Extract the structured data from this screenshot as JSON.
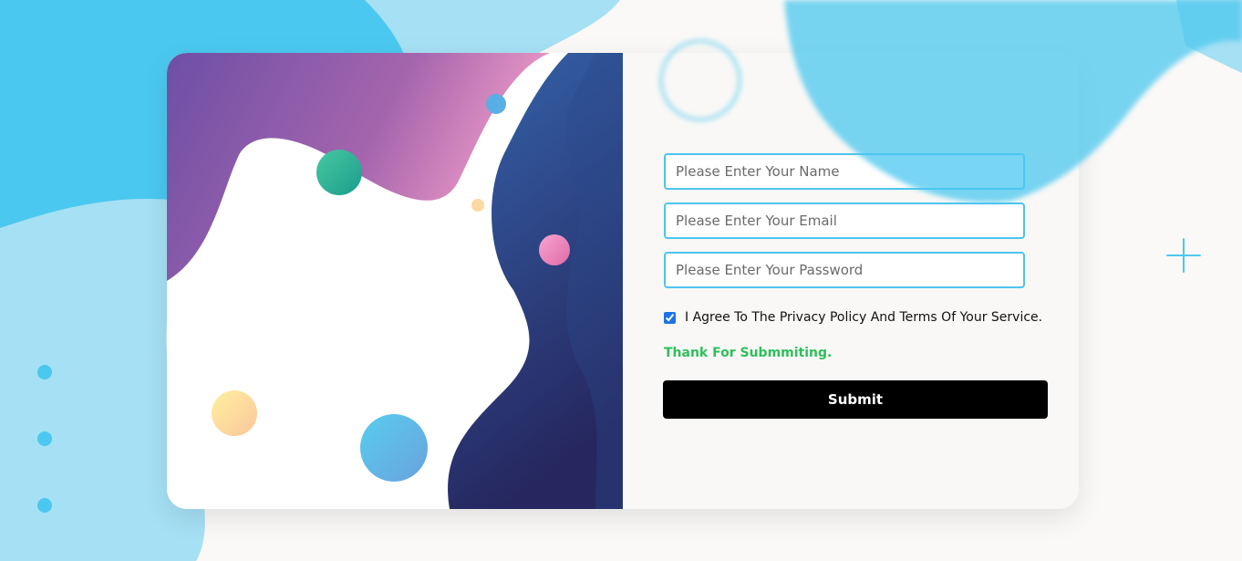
{
  "form": {
    "name_placeholder": "Please Enter Your Name",
    "email_placeholder": "Please Enter Your Email",
    "password_placeholder": "Please Enter Your Password",
    "agree_checked": true,
    "agree_label": "I Agree To The Privacy Policy And Terms Of Your Service.",
    "success_message": "Thank For Submmiting.",
    "submit_label": "Submit"
  },
  "colors": {
    "accent": "#4ec4ee",
    "success": "#2fbf5b",
    "submit_bg": "#000000"
  },
  "icons": [
    "plus-icon",
    "dot-icon"
  ]
}
